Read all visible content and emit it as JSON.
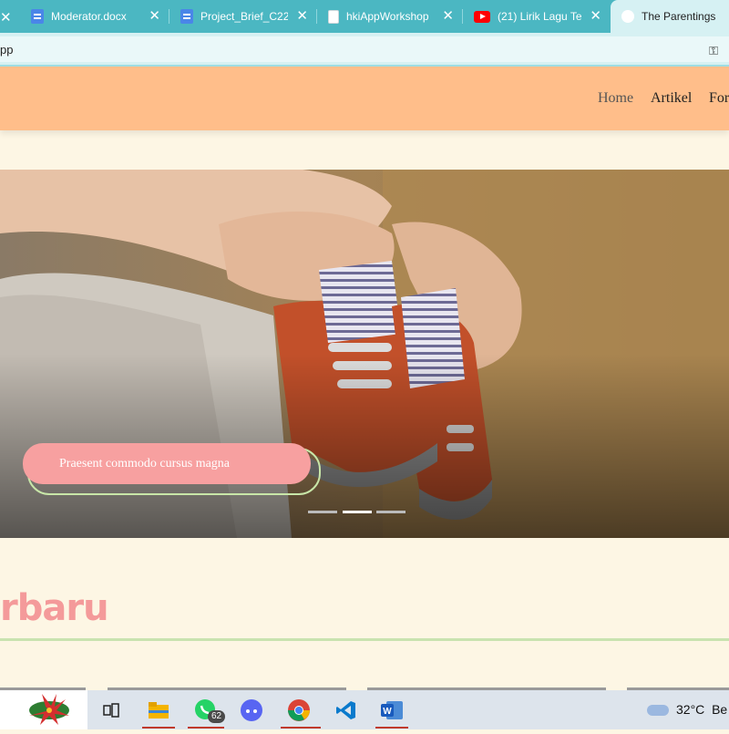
{
  "browser": {
    "tabs": [
      {
        "label": "Moderator.docx",
        "icon": "google-docs-icon"
      },
      {
        "label": "Project_Brief_C22",
        "icon": "google-docs-icon"
      },
      {
        "label": "hkiAppWorkshop",
        "icon": "file-icon"
      },
      {
        "label": "(21) Lirik Lagu Te",
        "icon": "youtube-icon"
      },
      {
        "label": "The Parentings",
        "icon": "site-icon",
        "active": true
      }
    ],
    "url": "pp"
  },
  "site": {
    "nav": {
      "home": "Home",
      "artikel": "Artikel",
      "forum": "For"
    },
    "hero": {
      "button_label": "Praesent commodo cursus magna",
      "slides": 3,
      "active_slide": 2
    },
    "section_title": "rbaru"
  },
  "taskbar": {
    "whatsapp_badge": "62",
    "weather_temp": "32°C",
    "weather_text": "Be"
  },
  "colors": {
    "tab_strip": "#4bb7c2",
    "header": "#ffbe8a",
    "page_bg": "#fdf6e4",
    "button": "#f7a0a0",
    "accent_green": "#c9e3b0",
    "title_pink": "#f49a9a"
  }
}
